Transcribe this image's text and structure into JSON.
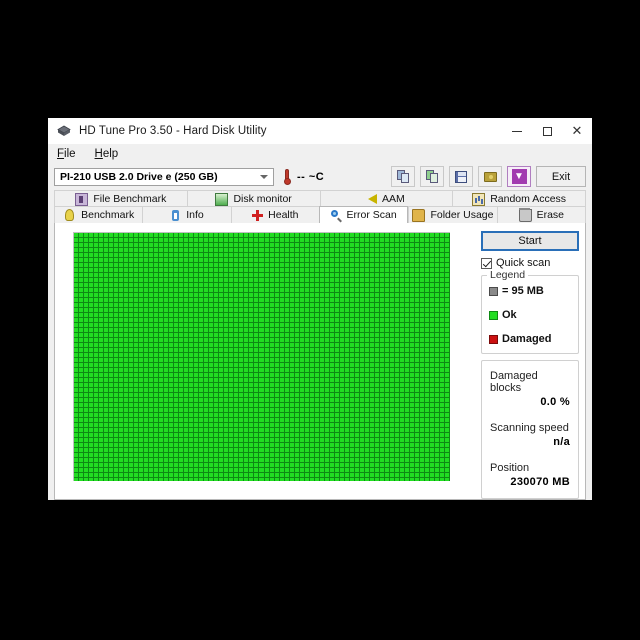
{
  "window": {
    "title": "HD Tune Pro 3.50 - Hard Disk Utility",
    "app_icon": "hdtune-diamond-icon",
    "controls": {
      "minimize": "minimize-icon",
      "maximize": "maximize-icon",
      "close": "close-icon"
    }
  },
  "menubar": {
    "items": [
      {
        "label": "File"
      },
      {
        "label": "Help"
      }
    ]
  },
  "toolbar": {
    "drive": {
      "value": "PI-210  USB 2.0 Drive e (250 GB)",
      "arrow_icon": "chevron-down-icon"
    },
    "temperature": {
      "icon": "thermometer-icon",
      "value": "--  ~C"
    },
    "buttons": [
      {
        "name": "copy-to-clipboard-button",
        "icon": "copy-blue-icon"
      },
      {
        "name": "copy-screenshot-button",
        "icon": "copy-green-icon"
      },
      {
        "name": "save-button",
        "icon": "floppy-save-icon"
      },
      {
        "name": "register-button",
        "icon": "money-icon"
      },
      {
        "name": "download-button",
        "icon": "download-arrow-icon"
      }
    ],
    "exit_label": "Exit"
  },
  "tabs": {
    "row1": [
      {
        "label": "File Benchmark",
        "icon": "file-benchmark-icon",
        "active": false
      },
      {
        "label": "Disk monitor",
        "icon": "disk-monitor-icon",
        "active": false
      },
      {
        "label": "AAM",
        "icon": "aam-speaker-icon",
        "active": false
      },
      {
        "label": "Random Access",
        "icon": "random-access-icon",
        "active": false
      }
    ],
    "row2": [
      {
        "label": "Benchmark",
        "icon": "lightbulb-icon",
        "active": false
      },
      {
        "label": "Info",
        "icon": "info-icon",
        "active": false
      },
      {
        "label": "Health",
        "icon": "health-cross-icon",
        "active": false
      },
      {
        "label": "Error Scan",
        "icon": "magnifier-icon",
        "active": true
      },
      {
        "label": "Folder Usage",
        "icon": "folder-icon",
        "active": false
      },
      {
        "label": "Erase",
        "icon": "trash-icon",
        "active": false
      }
    ]
  },
  "error_scan": {
    "start_label": "Start",
    "quick_scan": {
      "label": "Quick scan",
      "checked": true
    },
    "legend": {
      "title": "Legend",
      "block_size": "= 95 MB",
      "ok_label": "Ok",
      "damaged_label": "Damaged"
    },
    "stats": [
      {
        "label": "Damaged blocks",
        "value": "0.0 %"
      },
      {
        "label": "Scanning speed",
        "value": "n/a"
      },
      {
        "label": "Position",
        "value": "230070 MB"
      }
    ],
    "map": {
      "columns": 75,
      "rows": 50,
      "ok_color": "#22dd22",
      "grid_color": "#0e8a14",
      "damaged_color": "#cc1111",
      "total_blocks": 3750,
      "damaged_blocks": 0
    }
  }
}
